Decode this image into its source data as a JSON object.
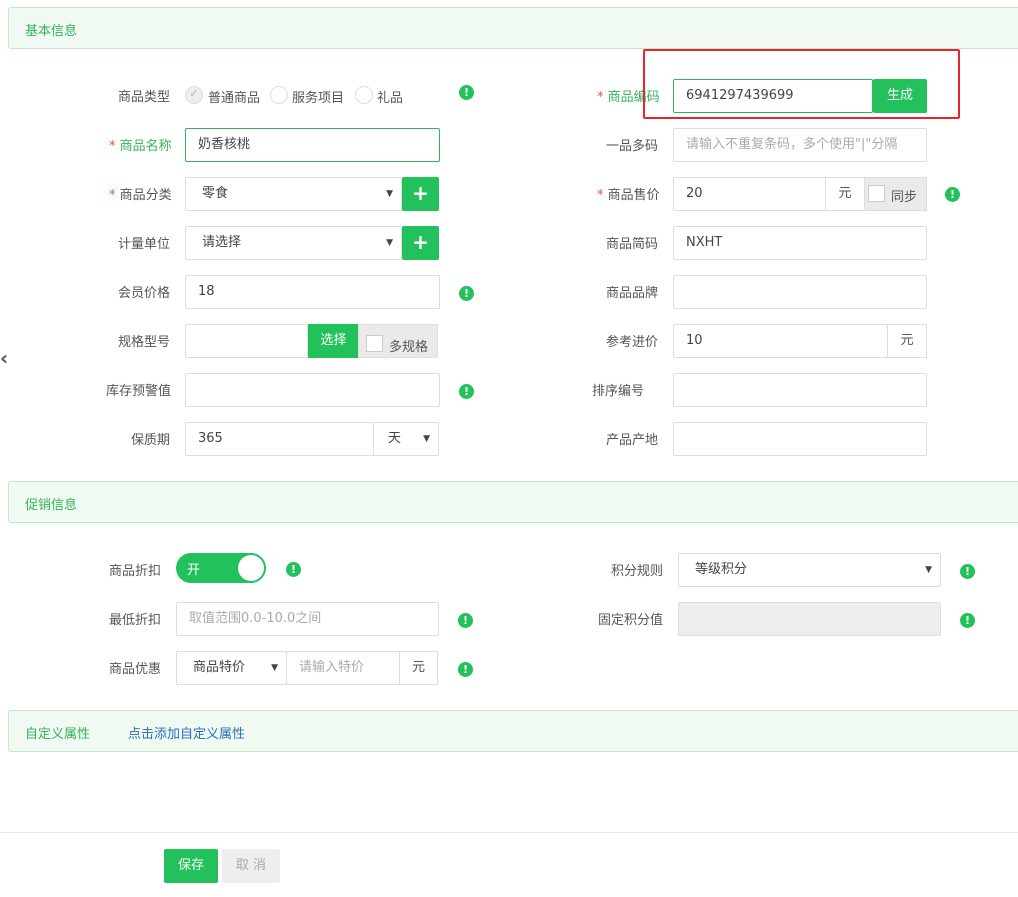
{
  "sections": {
    "basic": "基本信息",
    "promo": "促销信息",
    "custom": "自定义属性",
    "custom_link": "点击添加自定义属性"
  },
  "basic": {
    "type": {
      "label": "商品类型",
      "options": [
        "普通商品",
        "服务项目",
        "礼品"
      ],
      "selected": "普通商品"
    },
    "code": {
      "label": "商品编码",
      "value": "6941297439699",
      "button": "生成"
    },
    "name": {
      "label": "商品名称",
      "value": "奶香核桃"
    },
    "multi_code": {
      "label": "一品多码",
      "placeholder": "请输入不重复条码，多个使用\"|\"分隔"
    },
    "category": {
      "label": "商品分类",
      "value": "零食",
      "add": "+"
    },
    "price": {
      "label": "商品售价",
      "value": "20",
      "unit": "元",
      "sync": "同步"
    },
    "unit": {
      "label": "计量单位",
      "value": "请选择",
      "add": "+"
    },
    "short_code": {
      "label": "商品简码",
      "value": "NXHT"
    },
    "member_price": {
      "label": "会员价格",
      "value": "18"
    },
    "brand": {
      "label": "商品品牌",
      "value": ""
    },
    "spec": {
      "label": "规格型号",
      "value": "",
      "button": "选择",
      "multi": "多规格"
    },
    "cost": {
      "label": "参考进价",
      "value": "10",
      "unit": "元"
    },
    "stock_warn": {
      "label": "库存预警值",
      "value": ""
    },
    "sort": {
      "label": "排序编号",
      "value": ""
    },
    "shelf_life": {
      "label": "保质期",
      "value": "365",
      "unit": "天"
    },
    "origin": {
      "label": "产品产地",
      "value": ""
    }
  },
  "promo": {
    "discount": {
      "label": "商品折扣",
      "toggle": "开"
    },
    "points_rule": {
      "label": "积分规则",
      "value": "等级积分"
    },
    "min_discount": {
      "label": "最低折扣",
      "placeholder": "取值范围0.0-10.0之间"
    },
    "fixed_points": {
      "label": "固定积分值",
      "value": ""
    },
    "offer": {
      "label": "商品优惠",
      "type": "商品特价",
      "placeholder": "请输入特价",
      "unit": "元"
    }
  },
  "footer": {
    "save": "保存",
    "cancel": "取 消"
  },
  "icons": {
    "info": "info-icon",
    "back": "chevron-left-icon"
  },
  "colors": {
    "accent": "#23c15c",
    "highlight": "#e8262a"
  }
}
